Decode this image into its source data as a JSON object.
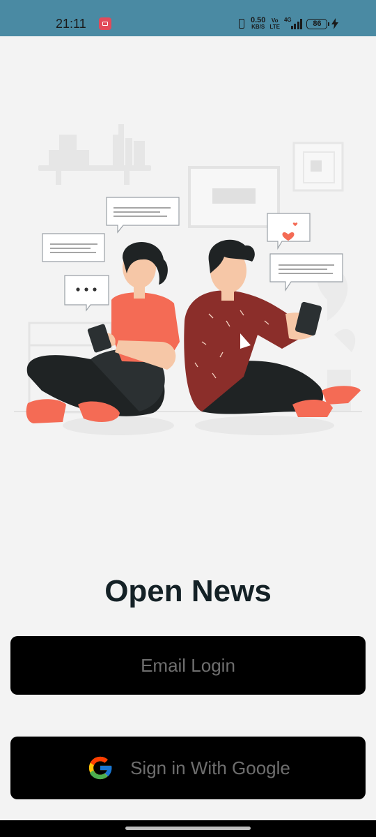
{
  "status_bar": {
    "time": "21:11",
    "net_speed_value": "0.50",
    "net_speed_unit": "KB/S",
    "volte": "Vo\nLTE",
    "signal_label": "4G",
    "battery": "86",
    "background": "#4a8aa3"
  },
  "illustration": {
    "name": "couple-using-phones-illustration"
  },
  "app": {
    "title": "Open News"
  },
  "buttons": {
    "email_login": "Email Login",
    "google_sign_in": "Sign in With Google"
  },
  "colors": {
    "accent": "#f46b55",
    "shirt_man": "#8b2e2a",
    "button_bg": "#000000",
    "title": "#142126"
  }
}
